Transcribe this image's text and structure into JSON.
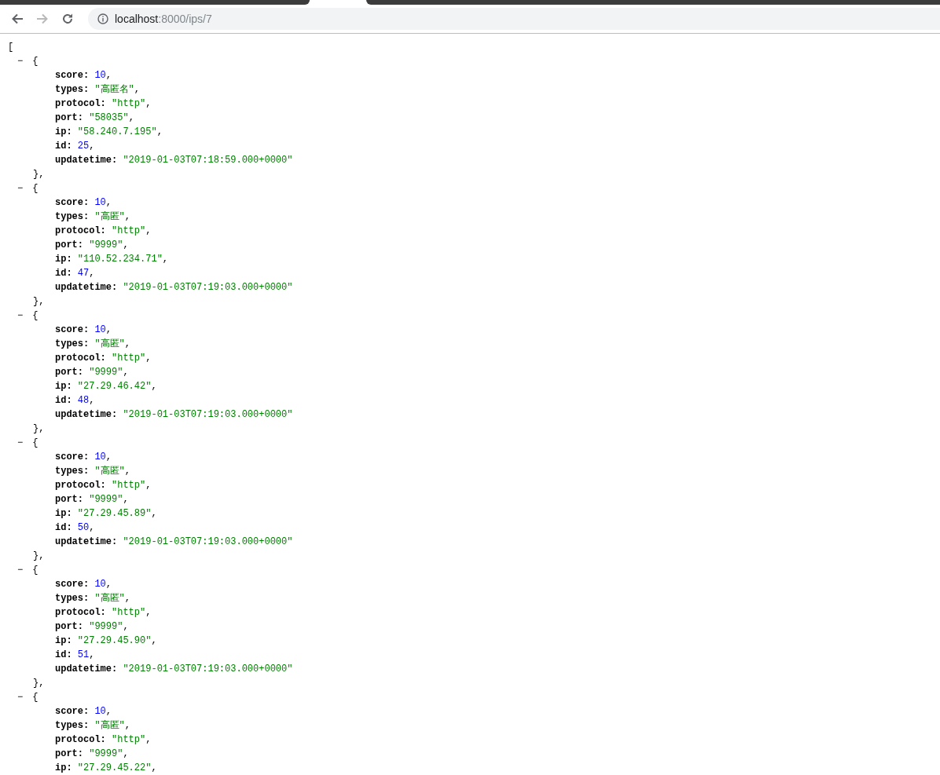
{
  "browser": {
    "back_disabled": false,
    "forward_disabled": true,
    "url_host": "localhost",
    "url_path": ":8000/ips/7"
  },
  "document": {
    "open": "[",
    "items": [
      {
        "toggle": "−",
        "open": "{",
        "close": "},",
        "fields": [
          {
            "key": "score:",
            "value": "10",
            "kind": "number",
            "comma": ","
          },
          {
            "key": "types:",
            "value": "\"高匿名\"",
            "kind": "string",
            "comma": ","
          },
          {
            "key": "protocol:",
            "value": "\"http\"",
            "kind": "string",
            "comma": ","
          },
          {
            "key": "port:",
            "value": "\"58035\"",
            "kind": "string",
            "comma": ","
          },
          {
            "key": "ip:",
            "value": "\"58.240.7.195\"",
            "kind": "string",
            "comma": ","
          },
          {
            "key": "id:",
            "value": "25",
            "kind": "number",
            "comma": ","
          },
          {
            "key": "updatetime:",
            "value": "\"2019-01-03T07:18:59.000+0000\"",
            "kind": "string"
          }
        ]
      },
      {
        "toggle": "−",
        "open": "{",
        "close": "},",
        "fields": [
          {
            "key": "score:",
            "value": "10",
            "kind": "number",
            "comma": ","
          },
          {
            "key": "types:",
            "value": "\"高匿\"",
            "kind": "string",
            "comma": ","
          },
          {
            "key": "protocol:",
            "value": "\"http\"",
            "kind": "string",
            "comma": ","
          },
          {
            "key": "port:",
            "value": "\"9999\"",
            "kind": "string",
            "comma": ","
          },
          {
            "key": "ip:",
            "value": "\"110.52.234.71\"",
            "kind": "string",
            "comma": ","
          },
          {
            "key": "id:",
            "value": "47",
            "kind": "number",
            "comma": ","
          },
          {
            "key": "updatetime:",
            "value": "\"2019-01-03T07:19:03.000+0000\"",
            "kind": "string"
          }
        ]
      },
      {
        "toggle": "−",
        "open": "{",
        "close": "},",
        "fields": [
          {
            "key": "score:",
            "value": "10",
            "kind": "number",
            "comma": ","
          },
          {
            "key": "types:",
            "value": "\"高匿\"",
            "kind": "string",
            "comma": ","
          },
          {
            "key": "protocol:",
            "value": "\"http\"",
            "kind": "string",
            "comma": ","
          },
          {
            "key": "port:",
            "value": "\"9999\"",
            "kind": "string",
            "comma": ","
          },
          {
            "key": "ip:",
            "value": "\"27.29.46.42\"",
            "kind": "string",
            "comma": ","
          },
          {
            "key": "id:",
            "value": "48",
            "kind": "number",
            "comma": ","
          },
          {
            "key": "updatetime:",
            "value": "\"2019-01-03T07:19:03.000+0000\"",
            "kind": "string"
          }
        ]
      },
      {
        "toggle": "−",
        "open": "{",
        "close": "},",
        "fields": [
          {
            "key": "score:",
            "value": "10",
            "kind": "number",
            "comma": ","
          },
          {
            "key": "types:",
            "value": "\"高匿\"",
            "kind": "string",
            "comma": ","
          },
          {
            "key": "protocol:",
            "value": "\"http\"",
            "kind": "string",
            "comma": ","
          },
          {
            "key": "port:",
            "value": "\"9999\"",
            "kind": "string",
            "comma": ","
          },
          {
            "key": "ip:",
            "value": "\"27.29.45.89\"",
            "kind": "string",
            "comma": ","
          },
          {
            "key": "id:",
            "value": "50",
            "kind": "number",
            "comma": ","
          },
          {
            "key": "updatetime:",
            "value": "\"2019-01-03T07:19:03.000+0000\"",
            "kind": "string"
          }
        ]
      },
      {
        "toggle": "−",
        "open": "{",
        "close": "},",
        "fields": [
          {
            "key": "score:",
            "value": "10",
            "kind": "number",
            "comma": ","
          },
          {
            "key": "types:",
            "value": "\"高匿\"",
            "kind": "string",
            "comma": ","
          },
          {
            "key": "protocol:",
            "value": "\"http\"",
            "kind": "string",
            "comma": ","
          },
          {
            "key": "port:",
            "value": "\"9999\"",
            "kind": "string",
            "comma": ","
          },
          {
            "key": "ip:",
            "value": "\"27.29.45.90\"",
            "kind": "string",
            "comma": ","
          },
          {
            "key": "id:",
            "value": "51",
            "kind": "number",
            "comma": ","
          },
          {
            "key": "updatetime:",
            "value": "\"2019-01-03T07:19:03.000+0000\"",
            "kind": "string"
          }
        ]
      },
      {
        "toggle": "−",
        "open": "{",
        "fields": [
          {
            "key": "score:",
            "value": "10",
            "kind": "number",
            "comma": ","
          },
          {
            "key": "types:",
            "value": "\"高匿\"",
            "kind": "string",
            "comma": ","
          },
          {
            "key": "protocol:",
            "value": "\"http\"",
            "kind": "string",
            "comma": ","
          },
          {
            "key": "port:",
            "value": "\"9999\"",
            "kind": "string",
            "comma": ","
          },
          {
            "key": "ip:",
            "value": "\"27.29.45.22\"",
            "kind": "string",
            "comma": ","
          }
        ]
      }
    ]
  }
}
